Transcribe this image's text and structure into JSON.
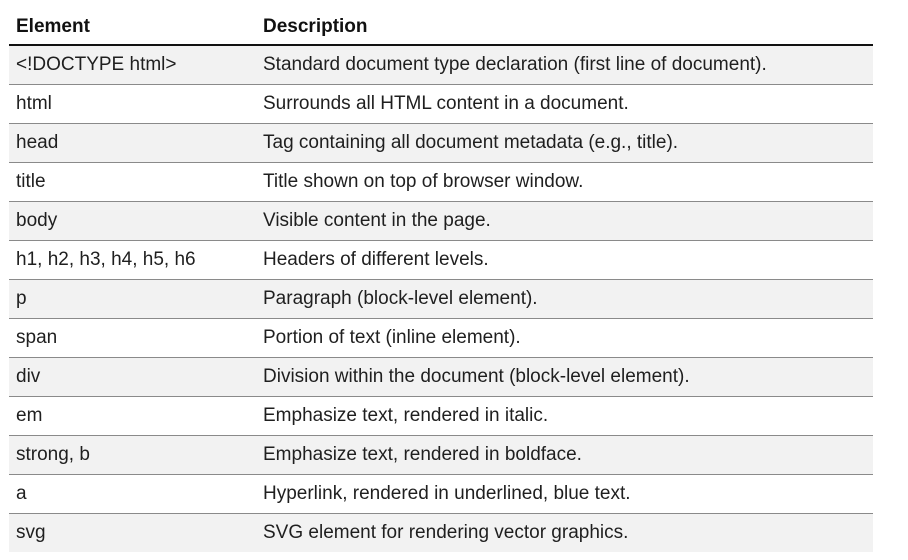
{
  "table": {
    "headers": [
      "Element",
      "Description"
    ],
    "rows": [
      {
        "element": "<!DOCTYPE html>",
        "description": "Standard document type declaration (first line of document)."
      },
      {
        "element": "html",
        "description": "Surrounds all HTML content in a document."
      },
      {
        "element": "head",
        "description": "Tag containing all document metadata (e.g., title)."
      },
      {
        "element": "title",
        "description": "Title shown on top of browser window."
      },
      {
        "element": "body",
        "description": "Visible content in the page."
      },
      {
        "element": "h1, h2, h3, h4, h5, h6",
        "description": "Headers of different levels."
      },
      {
        "element": "p",
        "description": "Paragraph (block-level element)."
      },
      {
        "element": "span",
        "description": "Portion of text (inline element)."
      },
      {
        "element": "div",
        "description": "Division within the document (block-level element)."
      },
      {
        "element": "em",
        "description": "Emphasize text, rendered in italic."
      },
      {
        "element": "strong, b",
        "description": "Emphasize text, rendered in boldface."
      },
      {
        "element": "a",
        "description": "Hyperlink, rendered in underlined, blue text."
      },
      {
        "element": "svg",
        "description": "SVG element for rendering vector graphics."
      }
    ]
  },
  "colors": {
    "row_stripe": "#f2f2f2",
    "row_plain": "#ffffff",
    "header_rule": "#111111",
    "row_rule": "#8a8a8a"
  }
}
